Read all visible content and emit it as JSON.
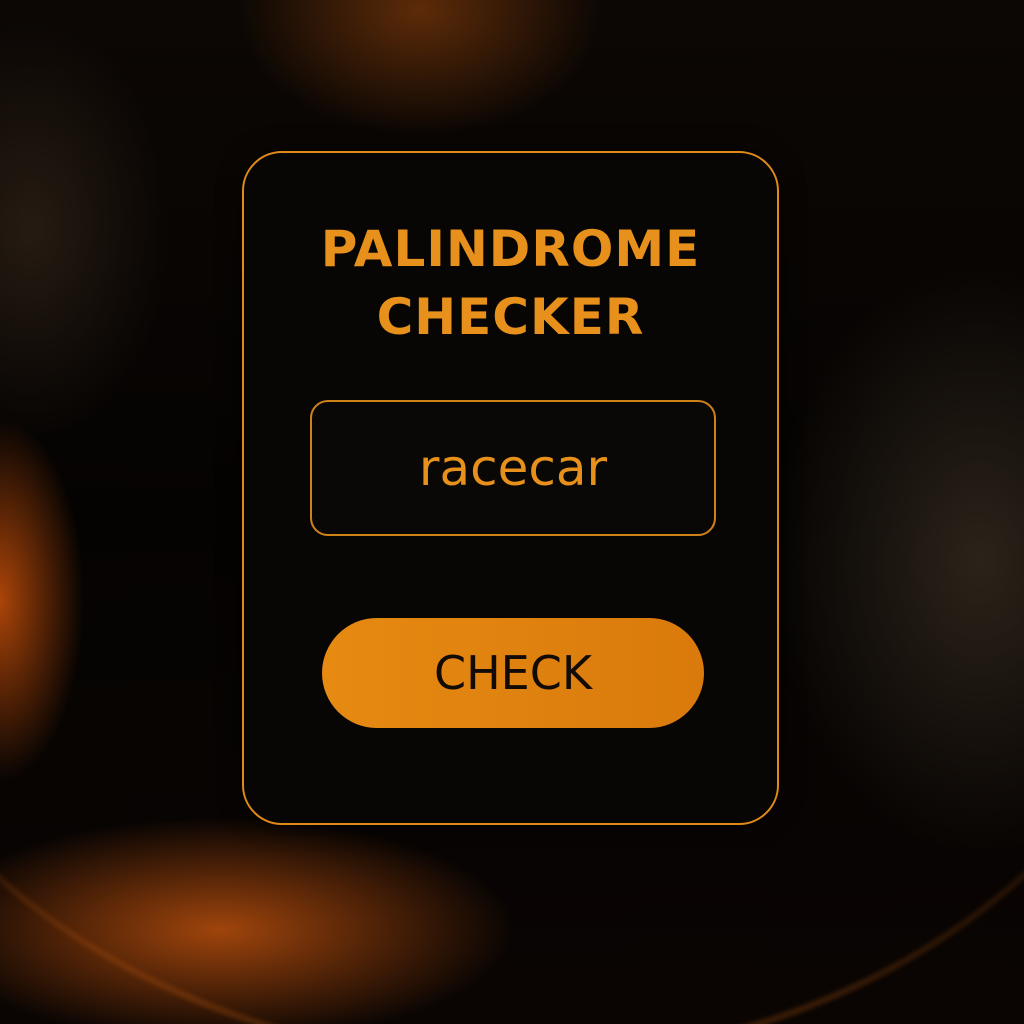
{
  "app": {
    "title_line1": "PALINDROME",
    "title_line2": "CHECKER"
  },
  "input": {
    "value": "racecar"
  },
  "button": {
    "label": "CHECK"
  },
  "colors": {
    "accent": "#e7901b",
    "button": "#e68a12",
    "card_background": "#080605",
    "page_background": "#050302"
  }
}
